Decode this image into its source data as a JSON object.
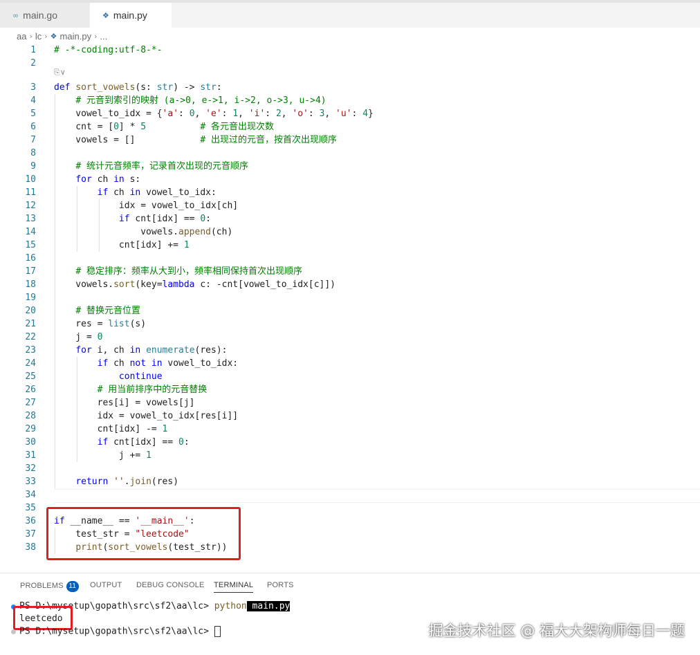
{
  "tabs": [
    {
      "label": "main.go",
      "icon": "go-file-icon",
      "active": false
    },
    {
      "label": "main.py",
      "icon": "python-file-icon",
      "active": true
    }
  ],
  "breadcrumb": {
    "parts": [
      "aa",
      "lc",
      "main.py",
      "..."
    ]
  },
  "editor": {
    "codelens": "⎘∨",
    "lines": [
      {
        "n": "1",
        "t": "# -*-coding:utf-8-*-"
      },
      {
        "n": "2",
        "t": ""
      },
      {
        "n": "3",
        "t": "def sort_vowels(s: str) -> str:"
      },
      {
        "n": "4",
        "t": "    # 元音到索引的映射 (a->0, e->1, i->2, o->3, u->4)"
      },
      {
        "n": "5",
        "t": "    vowel_to_idx = {'a': 0, 'e': 1, 'i': 2, 'o': 3, 'u': 4}"
      },
      {
        "n": "6",
        "t": "    cnt = [0] * 5          # 各元音出现次数"
      },
      {
        "n": "7",
        "t": "    vowels = []            # 出现过的元音，按首次出现顺序"
      },
      {
        "n": "8",
        "t": ""
      },
      {
        "n": "9",
        "t": "    # 统计元音频率，记录首次出现的元音顺序"
      },
      {
        "n": "10",
        "t": "    for ch in s:"
      },
      {
        "n": "11",
        "t": "        if ch in vowel_to_idx:"
      },
      {
        "n": "12",
        "t": "            idx = vowel_to_idx[ch]"
      },
      {
        "n": "13",
        "t": "            if cnt[idx] == 0:"
      },
      {
        "n": "14",
        "t": "                vowels.append(ch)"
      },
      {
        "n": "15",
        "t": "            cnt[idx] += 1"
      },
      {
        "n": "16",
        "t": ""
      },
      {
        "n": "17",
        "t": "    # 稳定排序：频率从大到小，频率相同保持首次出现顺序"
      },
      {
        "n": "18",
        "t": "    vowels.sort(key=lambda c: -cnt[vowel_to_idx[c]])"
      },
      {
        "n": "19",
        "t": ""
      },
      {
        "n": "20",
        "t": "    # 替换元音位置"
      },
      {
        "n": "21",
        "t": "    res = list(s)"
      },
      {
        "n": "22",
        "t": "    j = 0"
      },
      {
        "n": "23",
        "t": "    for i, ch in enumerate(res):"
      },
      {
        "n": "24",
        "t": "        if ch not in vowel_to_idx:"
      },
      {
        "n": "25",
        "t": "            continue"
      },
      {
        "n": "26",
        "t": "        # 用当前排序中的元音替换"
      },
      {
        "n": "27",
        "t": "        res[i] = vowels[j]"
      },
      {
        "n": "28",
        "t": "        idx = vowel_to_idx[res[i]]"
      },
      {
        "n": "29",
        "t": "        cnt[idx] -= 1"
      },
      {
        "n": "30",
        "t": "        if cnt[idx] == 0:"
      },
      {
        "n": "31",
        "t": "            j += 1"
      },
      {
        "n": "32",
        "t": ""
      },
      {
        "n": "33",
        "t": "    return ''.join(res)"
      },
      {
        "n": "34",
        "t": ""
      },
      {
        "n": "35",
        "t": ""
      },
      {
        "n": "36",
        "t": "if __name__ == '__main__':"
      },
      {
        "n": "37",
        "t": "    test_str = \"leetcode\""
      },
      {
        "n": "38",
        "t": "    print(sort_vowels(test_str))"
      }
    ]
  },
  "panel": {
    "tabs": [
      {
        "label": "PROBLEMS",
        "badge": "11"
      },
      {
        "label": "OUTPUT"
      },
      {
        "label": "DEBUG CONSOLE"
      },
      {
        "label": "TERMINAL",
        "active": true
      },
      {
        "label": "PORTS"
      }
    ],
    "terminal": {
      "line1_prompt": "PS D:\\mysetup\\gopath\\src\\sf2\\aa\\lc> ",
      "line1_cmd": "python",
      "line1_arg": " main.py",
      "output": "leetcedo",
      "line3_prompt": "PS D:\\mysetup\\gopath\\src\\sf2\\aa\\lc> "
    }
  },
  "watermark": "掘金技术社区 @ 福大大架构师每日一题",
  "colors": {
    "keyword": "#0000ff",
    "comment": "#008000",
    "string": "#a31515",
    "number": "#098658",
    "function": "#795e26",
    "highlight_box": "#e02020",
    "badge": "#005fb8"
  }
}
